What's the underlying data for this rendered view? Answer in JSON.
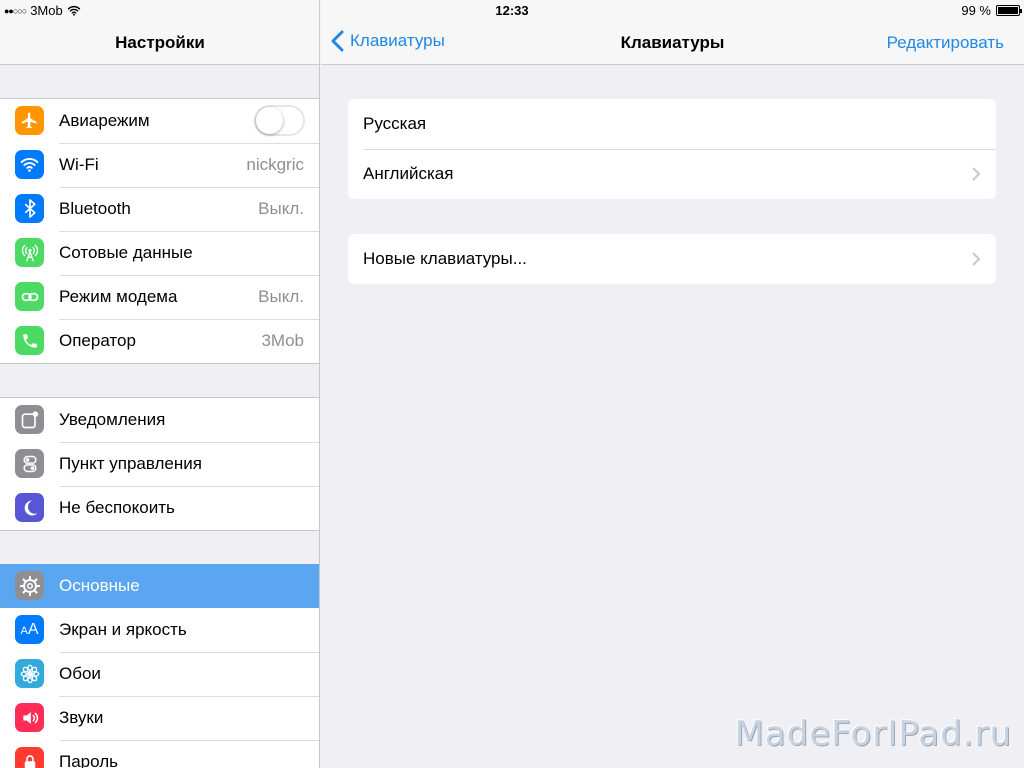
{
  "status_bar": {
    "carrier": "3Mob",
    "time": "12:33",
    "battery": "99 %",
    "battery_level": 0.99,
    "signal_icon": "signal-dots-icon",
    "wifi_icon": "wifi-icon"
  },
  "master": {
    "title": "Настройки",
    "groups": [
      {
        "items": [
          {
            "label": "Авиарежим",
            "icon": "airplane-icon",
            "color": "#ff9500",
            "toggle": false
          },
          {
            "label": "Wi-Fi",
            "icon": "wifi-icon",
            "color": "#007aff",
            "value": "nickgric"
          },
          {
            "label": "Bluetooth",
            "icon": "bluetooth-icon",
            "color": "#007aff",
            "value": "Выкл."
          },
          {
            "label": "Сотовые данные",
            "icon": "antenna-icon",
            "color": "#4cd964"
          },
          {
            "label": "Режим модема",
            "icon": "hotspot-icon",
            "color": "#4cd964",
            "value": "Выкл."
          },
          {
            "label": "Оператор",
            "icon": "phone-icon",
            "color": "#4cd964",
            "value": "3Mob"
          }
        ]
      },
      {
        "items": [
          {
            "label": "Уведомления",
            "icon": "notifications-icon",
            "color": "#8e8e93"
          },
          {
            "label": "Пункт управления",
            "icon": "control-center-icon",
            "color": "#8e8e93"
          },
          {
            "label": "Не беспокоить",
            "icon": "moon-icon",
            "color": "#5856d6"
          }
        ]
      },
      {
        "items": [
          {
            "label": "Основные",
            "icon": "gear-icon",
            "color": "#8e8e93",
            "selected": true
          },
          {
            "label": "Экран и яркость",
            "icon": "text-size-icon",
            "color": "#007aff",
            "icon_text": "AA"
          },
          {
            "label": "Обои",
            "icon": "wallpaper-flower-icon",
            "color": "#34aadc"
          },
          {
            "label": "Звуки",
            "icon": "speaker-icon",
            "color": "#ff2d55"
          },
          {
            "label": "Пароль",
            "icon": "lock-icon",
            "color": "#ff3b30"
          }
        ]
      }
    ]
  },
  "detail": {
    "back_label": "Клавиатуры",
    "title": "Клавиатуры",
    "edit_label": "Редактировать",
    "keyboards": [
      {
        "label": "Русская",
        "chevron": false
      },
      {
        "label": "Английская",
        "chevron": true
      }
    ],
    "new_keyboard": {
      "label": "Новые клавиатуры...",
      "chevron": true
    },
    "accent_color": "#1e88e5"
  },
  "watermark": "MadeForIPad.ru"
}
